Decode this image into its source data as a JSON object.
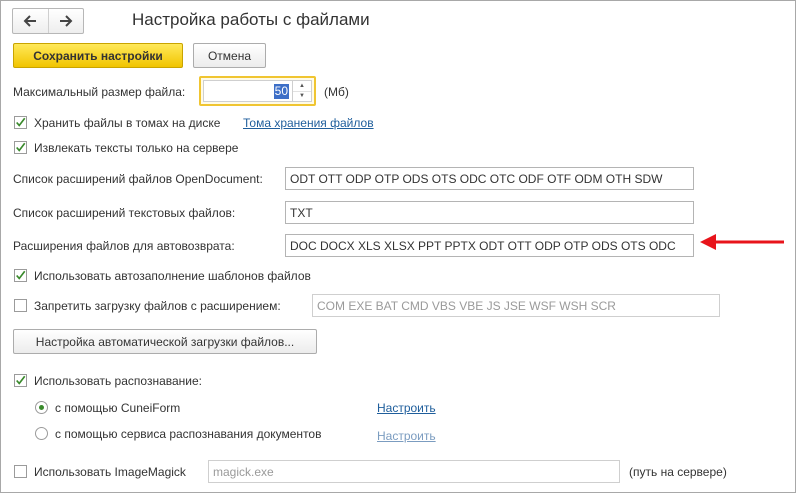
{
  "header": {
    "title": "Настройка работы с файлами",
    "back_icon": "arrow-left-icon",
    "forward_icon": "arrow-right-icon"
  },
  "toolbar": {
    "save_label": "Сохранить настройки",
    "cancel_label": "Отмена"
  },
  "max_file_size": {
    "label": "Максимальный размер файла:",
    "value": "50",
    "unit": "(Мб)"
  },
  "store_in_volumes": {
    "checked": true,
    "label": "Хранить файлы в томах на диске",
    "link": "Тома хранения файлов"
  },
  "extract_on_server": {
    "checked": true,
    "label": "Извлекать тексты только на сервере"
  },
  "opendocument_ext": {
    "label": "Список расширений файлов OpenDocument:",
    "value": "ODT OTT ODP OTP ODS OTS ODC OTC ODF OTF ODM OTH SDW"
  },
  "text_ext": {
    "label": "Список расширений текстовых файлов:",
    "value": "TXT"
  },
  "autoreturn_ext": {
    "label": "Расширения файлов для автовозврата:",
    "value": "DOC DOCX XLS XLSX PPT PPTX ODT OTT ODP OTP ODS OTS ODC"
  },
  "template_autofill": {
    "checked": true,
    "label": "Использовать автозаполнение шаблонов файлов"
  },
  "forbid_upload": {
    "checked": false,
    "label": "Запретить загрузку файлов с расширением:",
    "value": "COM EXE BAT CMD VBS VBE JS JSE WSF WSH SCR"
  },
  "auto_upload_settings_label": "Настройка автоматической загрузки файлов...",
  "recognition": {
    "checked": true,
    "label": "Использовать распознавание:",
    "options": [
      {
        "label": "с помощью CuneiForm",
        "selected": true,
        "link": "Настроить",
        "link_enabled": true
      },
      {
        "label": "с помощью сервиса распознавания документов",
        "selected": false,
        "link": "Настроить",
        "link_enabled": false
      }
    ]
  },
  "imagemagick": {
    "checked": false,
    "label": "Использовать ImageMagick",
    "value": "magick.exe",
    "note": "(путь на сервере)"
  },
  "annotation": {
    "arrow_color": "#e8141b"
  },
  "colors": {
    "primary_button": "#f5d000",
    "link": "#1f5e9c",
    "check": "#3a8a2c"
  }
}
